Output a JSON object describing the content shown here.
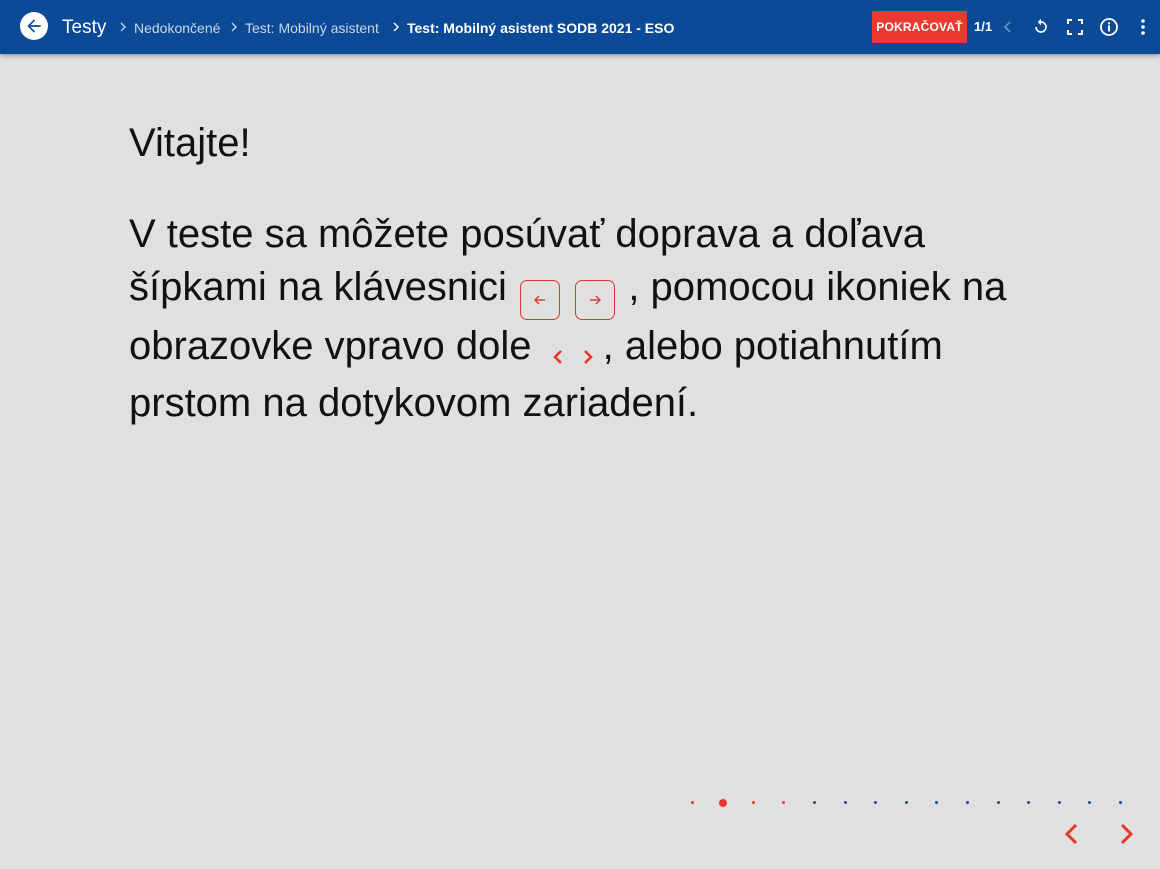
{
  "topbar": {
    "title": "Testy",
    "breadcrumbs": [
      "Nedokončené",
      "Test: Mobilný asistent",
      "Test: Mobilný asistent SODB 2021 - ESO"
    ],
    "continue_label": "POKRAČOVAŤ",
    "page_count": "1/1",
    "colors": {
      "bar": "#0b4a97",
      "accent": "#ea3a2f"
    }
  },
  "content": {
    "heading": "Vitajte!",
    "para_part1": "V teste sa môžete posúvať doprava a doľava šípkami na klávesnici",
    "para_part2": ", pomocou ikoniek na obrazovke vpravo dole",
    "para_part3": ", alebo potiahnutím prstom na dotykovom zariadení."
  },
  "pagination": {
    "total": 15,
    "active_index": 1,
    "visited_count": 4,
    "colors": {
      "visited": "#e8372c",
      "unvisited": "#1d4f9a"
    }
  },
  "icons": {
    "back": "arrow-left-icon",
    "prev_disabled": "chevron-left-icon",
    "restart": "refresh-icon",
    "fullscreen": "fullscreen-icon",
    "info": "info-icon",
    "more": "more-vertical-icon"
  }
}
